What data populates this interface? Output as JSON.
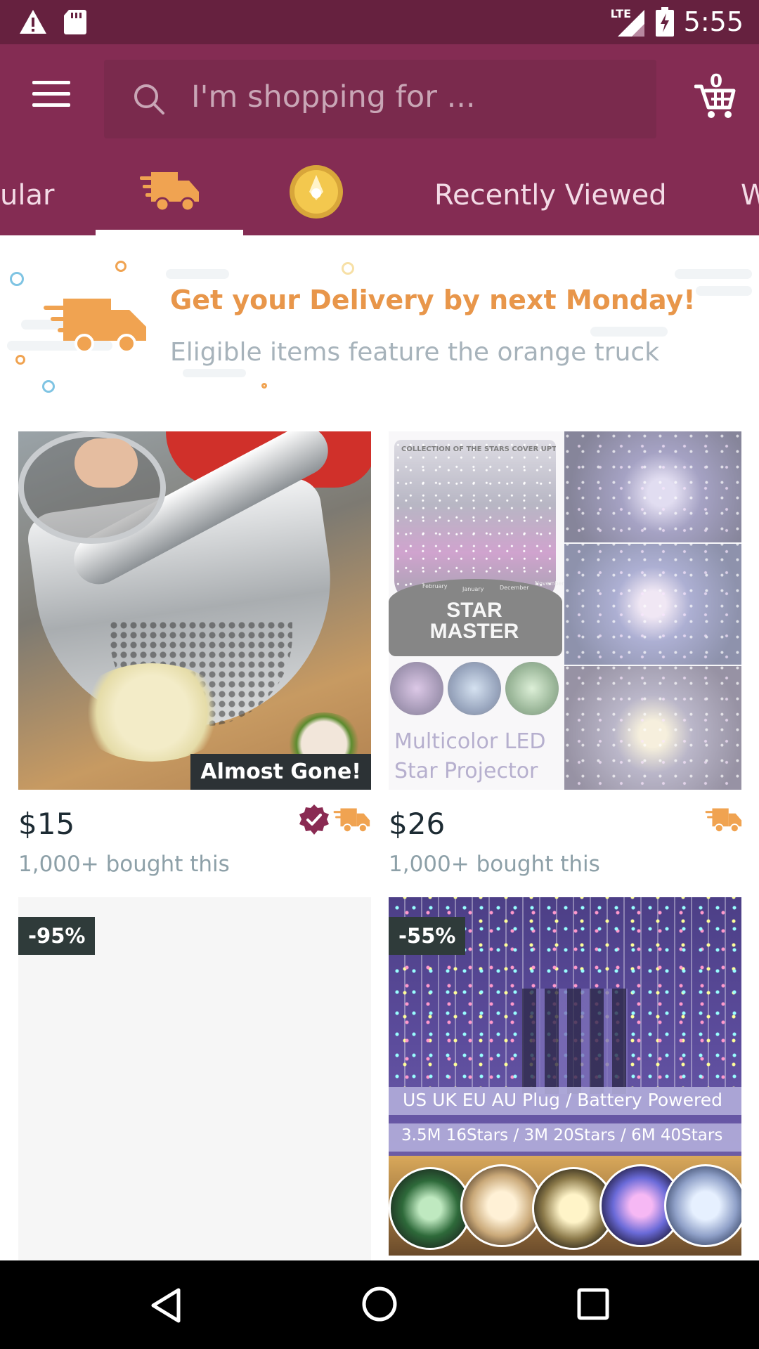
{
  "status_bar": {
    "network": "LTE",
    "time": "5:55",
    "icons": [
      "warning-icon",
      "sd-card-icon",
      "signal-icon",
      "battery-charging-icon"
    ]
  },
  "header": {
    "search_placeholder": "I'm shopping for ...",
    "cart_count": "0",
    "tabs": [
      {
        "label": "ular",
        "icon": "none"
      },
      {
        "label": "",
        "icon": "delivery-truck-icon",
        "selected": true
      },
      {
        "label": "",
        "icon": "coin-icon"
      },
      {
        "label": "Recently Viewed",
        "icon": "none"
      },
      {
        "label": "W",
        "icon": "none"
      }
    ]
  },
  "banner": {
    "title": "Get your Delivery by next Monday!",
    "subtitle": "Eligible items feature the orange truck"
  },
  "products": [
    {
      "image_desc": "garlic press",
      "badge": "Almost Gone!",
      "price": "$15",
      "bought": "1,000+ bought this",
      "verified": true,
      "fast_delivery": true
    },
    {
      "image_desc": "star projector",
      "image_text_top": "COLLECTION OF THE STARS COVER UPTO",
      "image_brand": "STAR MASTER",
      "image_caption_1": "Multicolor LED",
      "image_caption_2": "Star Projector",
      "months": [
        "February",
        "January",
        "December",
        "November"
      ],
      "price": "$26",
      "bought": "1,000+ bought this",
      "verified": false,
      "fast_delivery": true
    },
    {
      "image_desc": "loading",
      "discount": "-95%"
    },
    {
      "image_desc": "snowflake curtain lights",
      "discount": "-55%",
      "image_caption_1": "US UK EU AU Plug  /  Battery Powered",
      "image_caption_2": "3.5M 16Stars / 3M 20Stars / 6M 40Stars"
    }
  ],
  "colors": {
    "status_bar": "#66213f",
    "app_bar": "#842c53",
    "accent_orange": "#e8964a",
    "verified_badge": "#8a2a52"
  },
  "nav": {
    "icons": [
      "back-icon",
      "home-icon",
      "recents-icon"
    ]
  }
}
